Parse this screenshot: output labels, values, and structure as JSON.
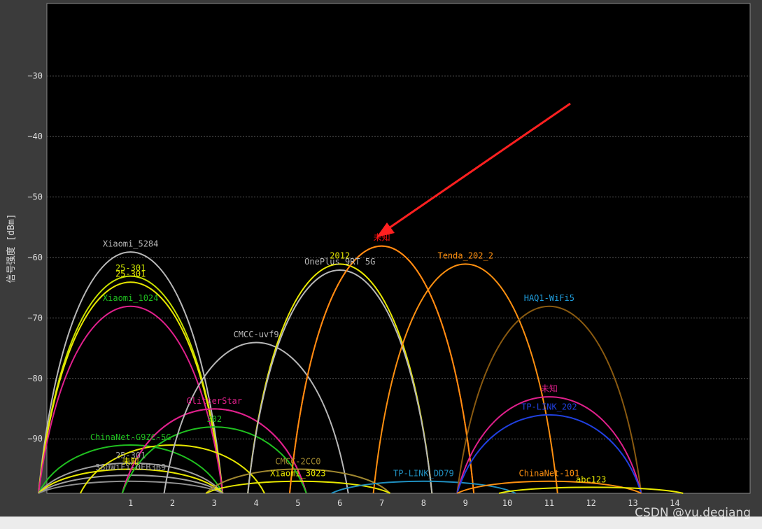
{
  "chart_data": {
    "type": "line",
    "title": "",
    "xlabel": "",
    "ylabel": "信号强度 [dBm]",
    "x_ticks": [
      1,
      2,
      3,
      4,
      5,
      6,
      7,
      8,
      9,
      10,
      11,
      12,
      13,
      14
    ],
    "y_ticks": [
      -30,
      -40,
      -50,
      -60,
      -70,
      -80,
      -90
    ],
    "xlim": [
      -1,
      15.8
    ],
    "ylim": [
      -99,
      -18
    ],
    "grid": "horizontal dotted",
    "background": "#000000",
    "series": [
      {
        "name": "Xiaomi_5284",
        "channel": 1,
        "level": -59,
        "color": "#b8b8b8"
      },
      {
        "name": "25-301",
        "channel": 1,
        "level": -63,
        "color": "#c8e000"
      },
      {
        "name": "25-301",
        "channel": 1,
        "level": -64,
        "color": "#e8e800"
      },
      {
        "name": "Xiaomi_1024",
        "channel": 1,
        "level": -68,
        "color": "#e0208c",
        "label_color": "#20c020"
      },
      {
        "name": "ChinaNet-G9ZC-5G",
        "channel": 1,
        "level": -91,
        "color": "#20c020"
      },
      {
        "name": "25-301",
        "channel": 1,
        "level": -94,
        "color": "#a0a0a0"
      },
      {
        "name": "360WiFi-0EB3B9",
        "channel": 1,
        "level": -96,
        "color": "#a0a0a0"
      },
      {
        "name": "未知",
        "channel": 1,
        "level": -95,
        "color": "#e8e800"
      },
      {
        "name": "",
        "channel": 1,
        "level": -97,
        "color": "#909090"
      },
      {
        "name": "",
        "channel": 2,
        "level": -91,
        "color": "#e8e800"
      },
      {
        "name": "",
        "channel": 3,
        "level": -85,
        "color": "#e0208c"
      },
      {
        "name": "GlitterStar",
        "channel": 3,
        "level": -85,
        "color": "#e0208c"
      },
      {
        "name": "302",
        "channel": 3,
        "level": -88,
        "color": "#20c020"
      },
      {
        "name": "CMCC-uvf9",
        "channel": 4,
        "level": -74,
        "color": "#b8b8b8"
      },
      {
        "name": "CMCC-2CC0",
        "channel": 5,
        "level": -95,
        "color": "#a08830"
      },
      {
        "name": "Xiaomi_3023",
        "channel": 5,
        "level": -97,
        "color": "#e8e800"
      },
      {
        "name": "2012",
        "channel": 6,
        "level": -61,
        "color": "#e8e800"
      },
      {
        "name": "OnePlus 9RT 5G",
        "channel": 6,
        "level": -62,
        "color": "#b8b8b8"
      },
      {
        "name": "未知",
        "channel": 7,
        "level": -58,
        "color": "#ff1010"
      },
      {
        "name": "",
        "channel": 7,
        "level": -58,
        "color": "#ff9010"
      },
      {
        "name": "Tenda_202_2",
        "channel": 9,
        "level": -61,
        "color": "#ff9010"
      },
      {
        "name": "TP-LINK_DD79",
        "channel": 8,
        "level": -97,
        "color": "#2090c0"
      },
      {
        "name": "HAQ1-WiFi5",
        "channel": 11,
        "level": -68,
        "color": "#8a5a10",
        "label_color": "#20a0e0"
      },
      {
        "name": "未知",
        "channel": 11,
        "level": -83,
        "color": "#e0208c"
      },
      {
        "name": "TP-LINK_202",
        "channel": 11,
        "level": -86,
        "color": "#2040e0"
      },
      {
        "name": "ChinaNet-101",
        "channel": 11,
        "level": -97,
        "color": "#ff9010"
      },
      {
        "name": "abc123",
        "channel": 12,
        "level": -98,
        "color": "#e8e800"
      }
    ]
  },
  "watermark": "CSDN @yu.deqiang"
}
